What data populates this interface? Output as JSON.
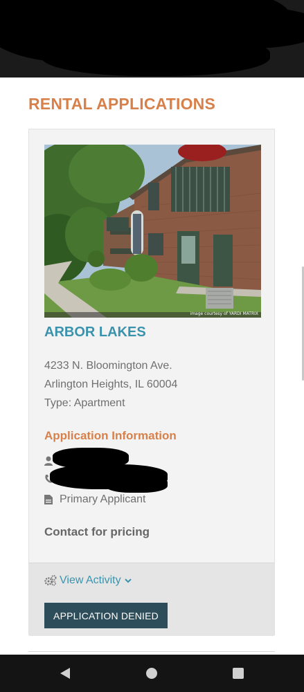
{
  "page": {
    "title": "RENTAL APPLICATIONS"
  },
  "property": {
    "name": "ARBOR LAKES",
    "address_line1": "4233 N. Bloomington Ave.",
    "address_line2": "Arlington Heights, IL 60004",
    "type": "Type: Apartment",
    "photo_credit": "image courtesy of YARDI MATRIX"
  },
  "application": {
    "section_title": "Application Information",
    "role": "Primary Applicant",
    "pricing": "Contact for pricing",
    "view_activity_label": "View Activity",
    "status_button_label": "APPLICATION DENIED"
  },
  "icons": {
    "user": "user-icon",
    "phone": "phone-icon",
    "document": "document-icon",
    "gears": "gears-icon",
    "chevron": "chevron-down-icon",
    "back": "back-icon",
    "home": "home-icon",
    "recents": "recents-icon"
  },
  "colors": {
    "accent_orange": "#d8804a",
    "link_teal": "#3a93ad",
    "button_bg": "#2e4d5a",
    "card_bg": "#f3f3f3",
    "footer_bg": "#e5e5e5"
  }
}
